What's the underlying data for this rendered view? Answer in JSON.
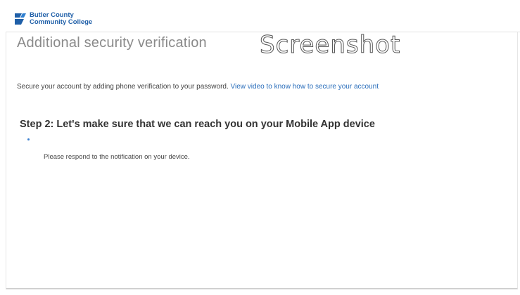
{
  "header": {
    "logo_line1": "Butler County",
    "logo_line2": "Community College",
    "logo_color": "#1f5fa8"
  },
  "page": {
    "title": "Additional security verification",
    "watermark": "Screenshot",
    "intro_text": "Secure your account by adding phone verification to your password.",
    "intro_link": "View video to know how to secure your account",
    "step_title": "Step 2: Let's make sure that we can reach you on your Mobile App device",
    "notice": "Please respond to the notification on your device.",
    "link_color": "#2a6ebb"
  }
}
